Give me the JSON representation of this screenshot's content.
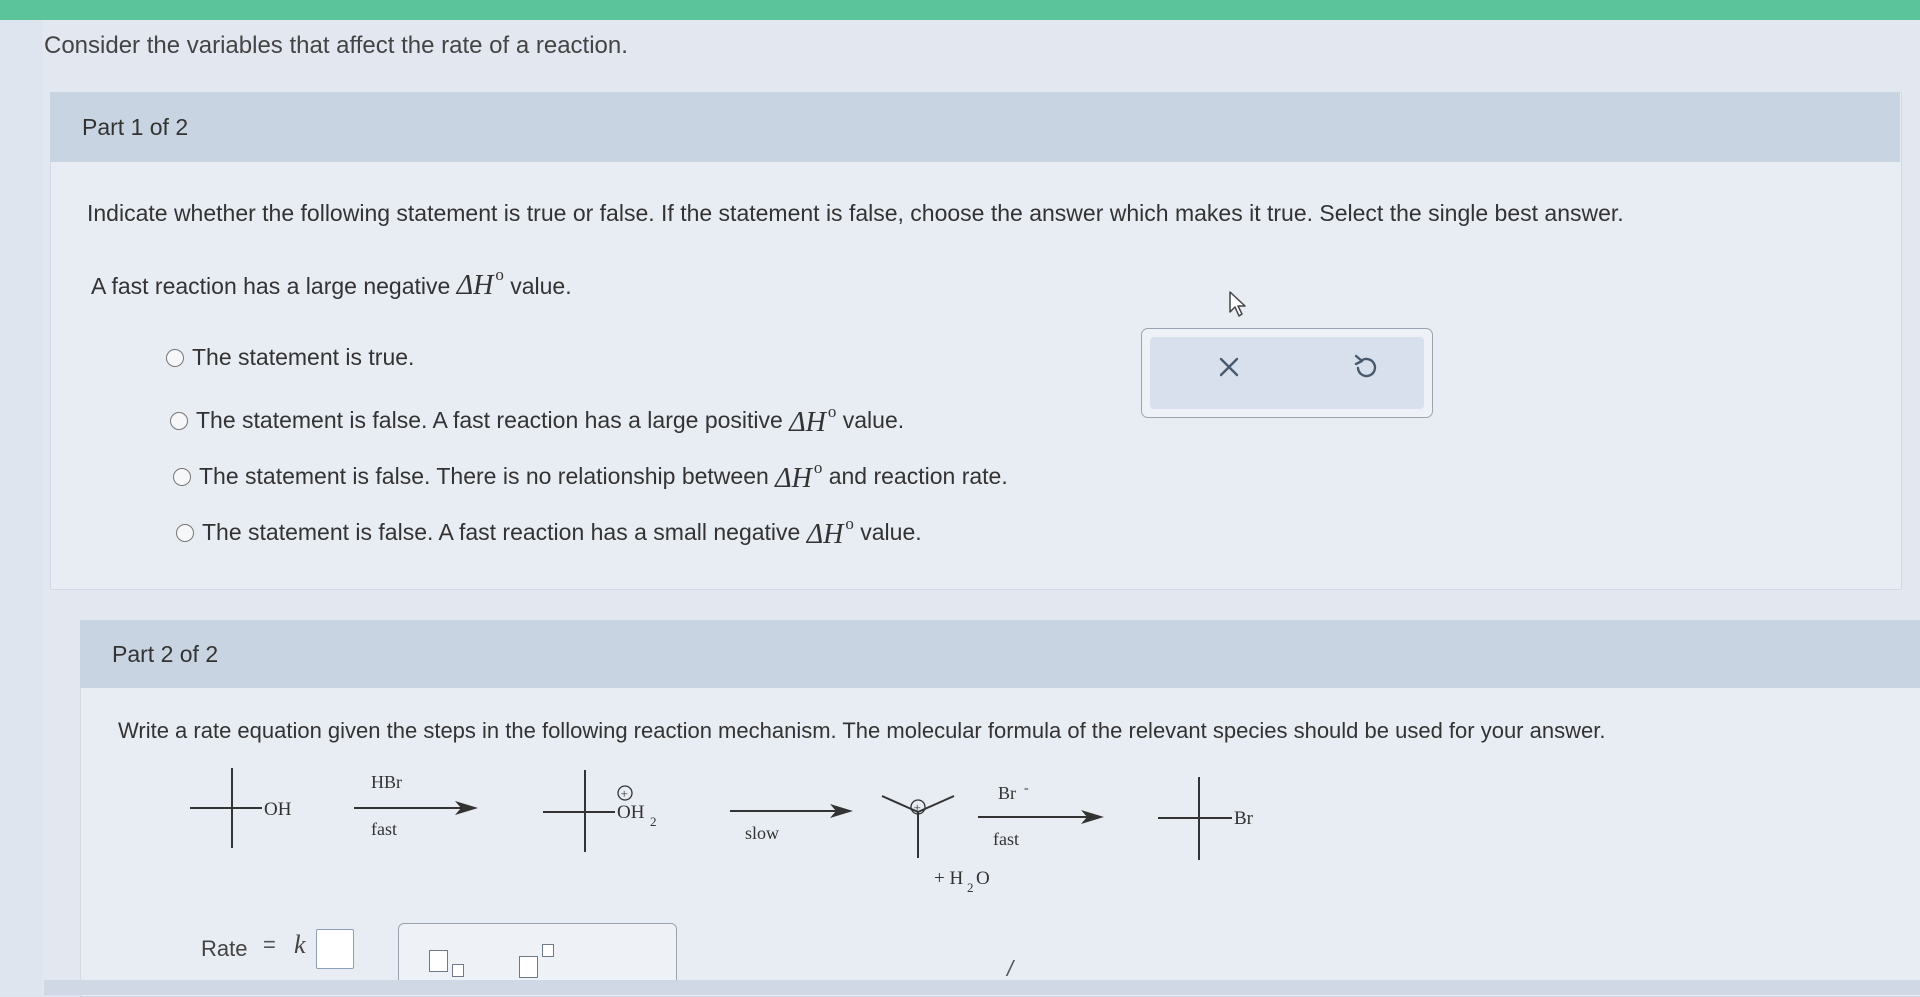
{
  "intro": "Consider the variables that affect the rate of a reaction.",
  "part1": {
    "header": "Part 1 of 2",
    "instructions": "Indicate whether the following statement is true or false. If the statement is false, choose the answer which makes it true. Select the single best answer.",
    "statement_before": "A fast reaction has a large negative",
    "statement_after": "value.",
    "delta_h": "ΔH",
    "degree": "o",
    "options": [
      {
        "text": "The statement is true."
      },
      {
        "before": "The statement is false. A fast reaction has a large positive",
        "after": "value."
      },
      {
        "before": "The statement is false. There is no relationship between",
        "after": "and reaction rate."
      },
      {
        "before": "The statement is false. A fast reaction has a small negative",
        "after": "value."
      }
    ],
    "tools": {
      "clear_icon": "close-x-icon",
      "undo_icon": "undo-icon"
    }
  },
  "part2": {
    "header": "Part 2 of 2",
    "instructions": "Write a rate equation given the steps in the following reaction mechanism. The molecular formula of the relevant species should be used for your answer.",
    "mechanism": {
      "start_group": "OH",
      "step1_reagent": "HBr",
      "step1_condition": "fast",
      "intermediate1_group": "OH",
      "intermediate1_subscript": "2",
      "plus_charge": "+",
      "step2_condition": "slow",
      "byproduct_prefix": "+ H",
      "byproduct_subscript": "2",
      "byproduct_suffix": "O",
      "step3_reagent": "Br",
      "step3_reagent_charge": "-",
      "step3_condition": "fast",
      "product_group": "Br"
    },
    "rate_label": "Rate",
    "equals": "=",
    "k": "k"
  }
}
